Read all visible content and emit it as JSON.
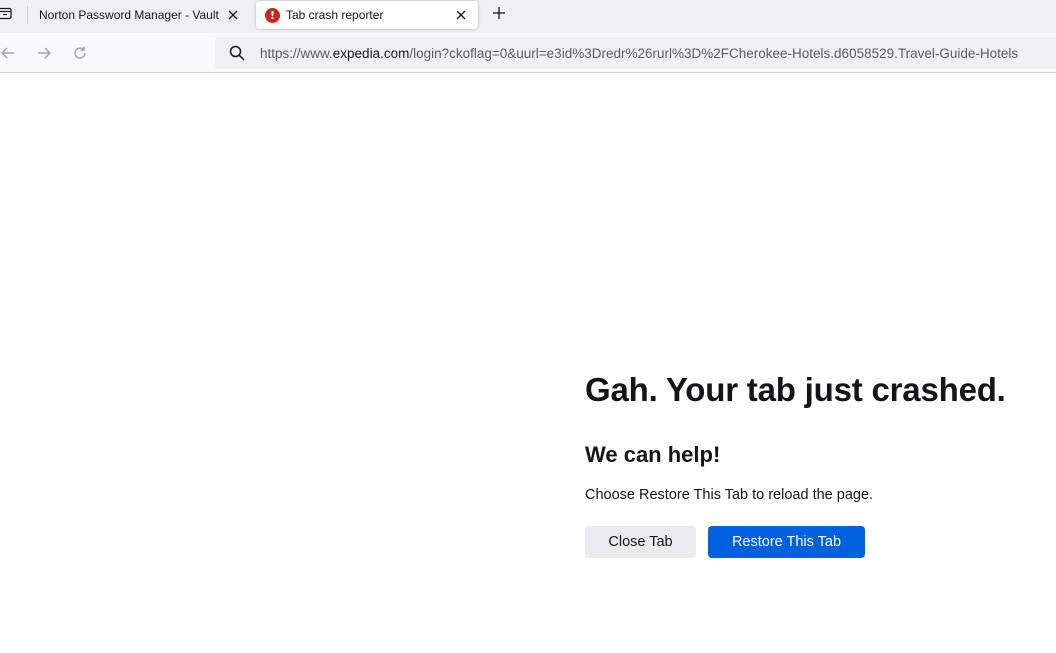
{
  "tabs": [
    {
      "label": "Norton Password Manager - Vault",
      "active": false
    },
    {
      "label": "Tab crash reporter",
      "active": true,
      "favicon": "error-icon"
    }
  ],
  "navbar": {
    "url_prefix": "https://www.",
    "url_host": "expedia.com",
    "url_rest": "/login?ckoflag=0&uurl=e3id%3Dredr%26rurl%3D%2FCherokee-Hotels.d6058529.Travel-Guide-Hotels"
  },
  "crash": {
    "title": "Gah. Your tab just crashed.",
    "subtitle": "We can help!",
    "message": "Choose Restore This Tab to reload the page.",
    "close_label": "Close Tab",
    "restore_label": "Restore This Tab"
  },
  "colors": {
    "accent": "#0061e0",
    "error": "#c42b1c"
  }
}
